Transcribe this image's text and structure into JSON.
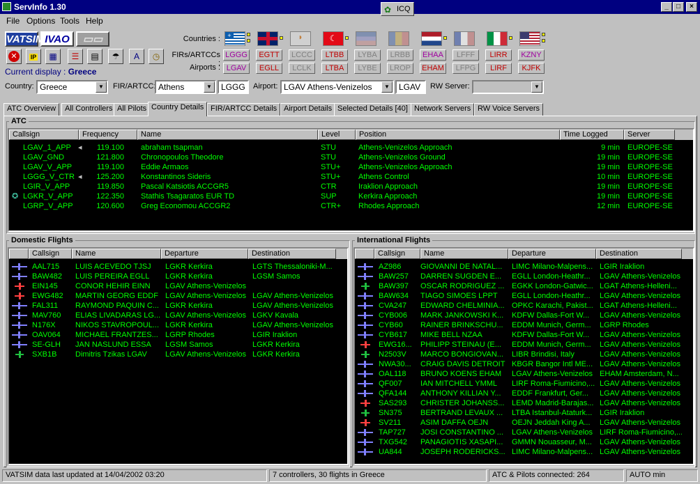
{
  "window": {
    "title": "ServInfo 1.30",
    "icq_label": "ICQ"
  },
  "menu": [
    "File",
    "Options",
    "Tools",
    "Help"
  ],
  "logos": {
    "vatsim": "VATSIM",
    "ivao": "IVAO"
  },
  "current_display": {
    "label": "Current display :",
    "value": "Greece"
  },
  "rows_labels": {
    "countries": "Countries :",
    "firs": "FIRs/ARTCCs :",
    "airports": "Airports :"
  },
  "country_codes": [
    {
      "fir": "LGGG",
      "airport": "LGAV",
      "fir_color": "#a000a0",
      "ap_color": "#a000a0"
    },
    {
      "fir": "EGTT",
      "airport": "EGLL",
      "fir_color": "#c00000",
      "ap_color": "#c00000"
    },
    {
      "fir": "LCCC",
      "airport": "LCLK",
      "fir_color": "#808080",
      "ap_color": "#808080"
    },
    {
      "fir": "LTBB",
      "airport": "LTBA",
      "fir_color": "#c00000",
      "ap_color": "#c00000"
    },
    {
      "fir": "LYBA",
      "airport": "LYBE",
      "fir_color": "#808080",
      "ap_color": "#808080"
    },
    {
      "fir": "LRBB",
      "airport": "LROP",
      "fir_color": "#808080",
      "ap_color": "#808080"
    },
    {
      "fir": "EHAA",
      "airport": "EHAM",
      "fir_color": "#a000a0",
      "ap_color": "#c00000"
    },
    {
      "fir": "LFFF",
      "airport": "LFPG",
      "fir_color": "#808080",
      "ap_color": "#808080"
    },
    {
      "fir": "LIRR",
      "airport": "LIRF",
      "fir_color": "#c00000",
      "ap_color": "#c00000"
    },
    {
      "fir": "KZNY",
      "airport": "KJFK",
      "fir_color": "#a000a0",
      "ap_color": "#c00000"
    }
  ],
  "selectors": {
    "country_label": "Country:",
    "country_value": "Greece",
    "fir_label": "FIR/ARTCC:",
    "fir_value": "Athens",
    "fir_code": "LGGG",
    "airport_label": "Airport:",
    "airport_value": "LGAV Athens-Venizelos",
    "airport_code": "LGAV",
    "rw_label": "RW Server:",
    "rw_value": ""
  },
  "tabs": [
    "ATC Overview",
    "All Controllers",
    "All Pilots",
    "Country Details",
    "FIR/ARTCC Details",
    "Airport Details",
    "Selected Details [40]",
    "Network Servers",
    "RW Voice Servers"
  ],
  "atc": {
    "title": "ATC",
    "headers": [
      "Callsign",
      "Frequency",
      "Name",
      "Level",
      "Position",
      "Time Logged",
      "Server"
    ],
    "rows": [
      [
        "LGAV_1_APP",
        "119.100",
        "abraham tsapman",
        "STU",
        "Athens-Venizelos Approach",
        "9 min",
        "EUROPE-SE"
      ],
      [
        "LGAV_GND",
        "121.800",
        "Chronopoulos Theodore",
        "STU",
        "Athens-Venizelos Ground",
        "19 min",
        "EUROPE-SE"
      ],
      [
        "LGAV_V_APP",
        "119.100",
        "Eddie Armaos",
        "STU+",
        "Athens-Venizelos Approach",
        "19 min",
        "EUROPE-SE"
      ],
      [
        "LGGG_V_CTR",
        "125.200",
        "Konstantinos Sideris",
        "STU+",
        "Athens Control",
        "10 min",
        "EUROPE-SE"
      ],
      [
        "LGIR_V_APP",
        "119.850",
        "Pascal Katsiotis ACCGR5",
        "CTR",
        "Iraklion Approach",
        "19 min",
        "EUROPE-SE"
      ],
      [
        "LGKR_V_APP",
        "122.350",
        "Stathis Tsagaratos EUR TD",
        "SUP",
        "Kerkira Approach",
        "19 min",
        "EUROPE-SE"
      ],
      [
        "LGRP_V_APP",
        "120.600",
        "Greg Economou ACCGR2",
        "CTR+",
        "Rhodes Approach",
        "12 min",
        "EUROPE-SE"
      ]
    ]
  },
  "domestic": {
    "title": "Domestic Flights",
    "headers": [
      "Callsign",
      "Name",
      "Departure",
      "Destination"
    ],
    "rows": [
      [
        "AAL715",
        "LUIS ACEVEDO TJSJ",
        "LGKR Kerkira",
        "LGTS Thessaloniki-M..."
      ],
      [
        "BAW482",
        "LUIS PEREIRA EGLL",
        "LGKR Kerkira",
        "LGSM Samos"
      ],
      [
        "EIN145",
        "CONOR HEHIR EINN",
        "LGAV Athens-Venizelos",
        ""
      ],
      [
        "EWG482",
        "MARTIN GEORG EDDF",
        "LGAV Athens-Venizelos",
        "LGAV Athens-Venizelos"
      ],
      [
        "FAL311",
        "RAYMOND PAQUIN C...",
        "LGKR Kerkira",
        "LGAV Athens-Venizelos"
      ],
      [
        "MAV760",
        "ELIAS LIVADARAS LG...",
        "LGAV Athens-Venizelos",
        "LGKV Kavala"
      ],
      [
        "N176X",
        "NIKOS STAVROPOUL...",
        "LGKR Kerkira",
        "LGAV Athens-Venizelos"
      ],
      [
        "OAV064",
        "MICHAEL FRANTZES...",
        "LGRP Rhodes",
        "LGIR Iraklion"
      ],
      [
        "SE-GLH",
        "JAN NASLUND ESSA",
        "LGSM Samos",
        "LGKR Kerkira"
      ],
      [
        "SXB1B",
        "Dimitris Tzikas LGAV",
        "LGAV Athens-Venizelos",
        "LGKR Kerkira"
      ]
    ]
  },
  "international": {
    "title": "International Flights",
    "headers": [
      "Callsign",
      "Name",
      "Departure",
      "Destination"
    ],
    "rows": [
      [
        "AZ986",
        "GIOVANNI DE NATAL...",
        "LIMC Milano-Malpens...",
        "LGIR Iraklion"
      ],
      [
        "BAW257",
        "DARREN SUGDEN E...",
        "EGLL London-Heathr...",
        "LGAV Athens-Venizelos"
      ],
      [
        "BAW397",
        "OSCAR RODRIGUEZ ...",
        "EGKK London-Gatwic...",
        "LGAT Athens-Helleni..."
      ],
      [
        "BAW634",
        "TIAGO SIMOES LPPT",
        "EGLL London-Heathr...",
        "LGAV Athens-Venizelos"
      ],
      [
        "CVA247",
        "EDWARD CHELMINIA...",
        "OPKC Karachi, Pakist...",
        "LGAT Athens-Helleni..."
      ],
      [
        "CYB006",
        "MARK JANKOWSKI K...",
        "KDFW Dallas-Fort W...",
        "LGAV Athens-Venizelos"
      ],
      [
        "CYB60",
        "RAINER BRINKSCHU...",
        "EDDM Munich, Germ...",
        "LGRP Rhodes"
      ],
      [
        "CYB617",
        "MIKE BELL NZAA",
        "KDFW Dallas-Fort W...",
        "LGAV Athens-Venizelos"
      ],
      [
        "EWG16...",
        "PHILIPP STEINAU (E...",
        "EDDM Munich, Germ...",
        "LGAV Athens-Venizelos"
      ],
      [
        "N2503V",
        "MARCO BONGIOVAN...",
        "LIBR Brindisi, Italy",
        "LGAV Athens-Venizelos"
      ],
      [
        "NWA30...",
        "CRAIG DAVIS DETROIT",
        "KBGR Bangor Intl ME...",
        "LGAV Athens-Venizelos"
      ],
      [
        "OAL118",
        "BRUNO KOENS EHAM",
        "LGAV Athens-Venizelos",
        "EHAM Amsterdam, N..."
      ],
      [
        "QF007",
        "IAN MITCHELL YMML",
        "LIRF Roma-Fiumicino,...",
        "LGAV Athens-Venizelos"
      ],
      [
        "QFA144",
        "ANTHONY KILLIAN Y...",
        "EDDF Frankfurt, Ger...",
        "LGAV Athens-Venizelos"
      ],
      [
        "SAS293",
        "CHRISTER JOHANSS...",
        "LEMD Madrid-Barajas...",
        "LGAV Athens-Venizelos"
      ],
      [
        "SN375",
        "BERTRAND LEVAUX ...",
        "LTBA Istanbul-Ataturk...",
        "LGIR Iraklion"
      ],
      [
        "SV211",
        "ASIM DAFFA OEJN",
        "OEJN Jeddah King A...",
        "LGAV Athens-Venizelos"
      ],
      [
        "TAP727",
        "JOSI CONSTANTINO ...",
        "LGAV Athens-Venizelos",
        "LIRF Roma-Fiumicino,..."
      ],
      [
        "TXG542",
        "PANAGIOTIS XASAPI...",
        "GMMN Nouasseur, M...",
        "LGAV Athens-Venizelos"
      ],
      [
        "UA844",
        "JOSEPH RODERICKS...",
        "LIMC Milano-Malpens...",
        "LGAV Athens-Venizelos"
      ]
    ]
  },
  "status": {
    "updated": "VATSIM data last updated at 14/04/2002 03:20",
    "counts": "7 controllers, 30 flights in Greece",
    "connected": "ATC & Pilots connected: 264",
    "auto": "AUTO min"
  },
  "colors": {
    "grid_text": "#00ff00",
    "grid_bg": "#000000",
    "title_bg": "#000080"
  }
}
